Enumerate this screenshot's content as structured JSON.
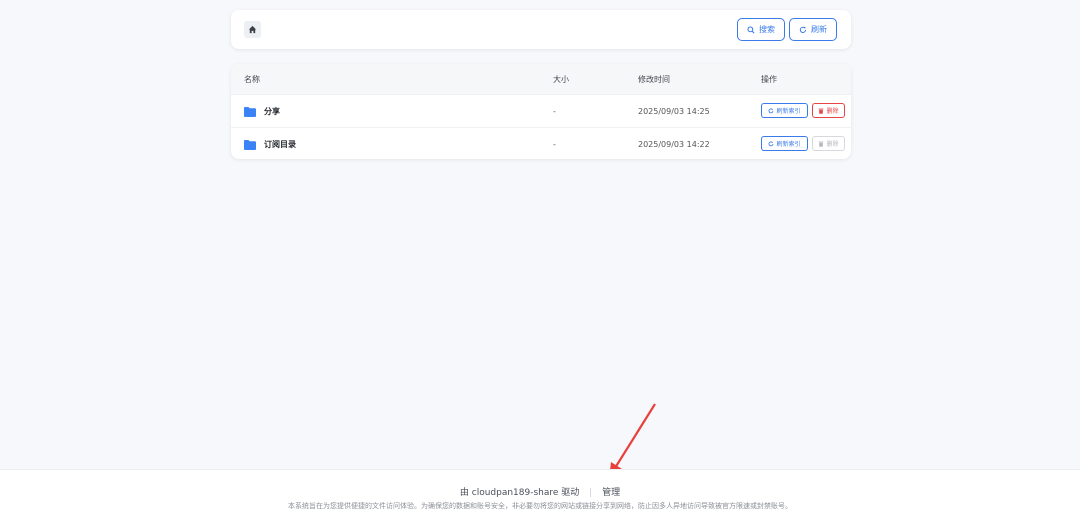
{
  "toolbar": {
    "search_label": "搜索",
    "refresh_label": "刷新"
  },
  "table": {
    "columns": [
      "名称",
      "大小",
      "修改时间",
      "操作"
    ],
    "rows": [
      {
        "name": "分享",
        "size": "-",
        "modified": "2025/09/03 14:25",
        "reindex_label": "刷新索引",
        "delete_label": "删除"
      },
      {
        "name": "订阅目录",
        "size": "-",
        "modified": "2025/09/03 14:22",
        "reindex_label": "刷新索引",
        "delete_label": "删除"
      }
    ]
  },
  "footer": {
    "powered_by": "由 cloudpan189-share 驱动",
    "admin_link": "管理",
    "notice": "本系统旨在为您提供便捷的文件访问体验。为确保您的数据和账号安全，非必要勿将您的网站或链接分享到网络，防止因多人异地访问导致被官方限速或封禁账号。"
  },
  "colors": {
    "accent": "#3a7bea",
    "danger": "#e54545",
    "folder": "#3b82f6",
    "annotation_arrow": "#e8403c"
  }
}
